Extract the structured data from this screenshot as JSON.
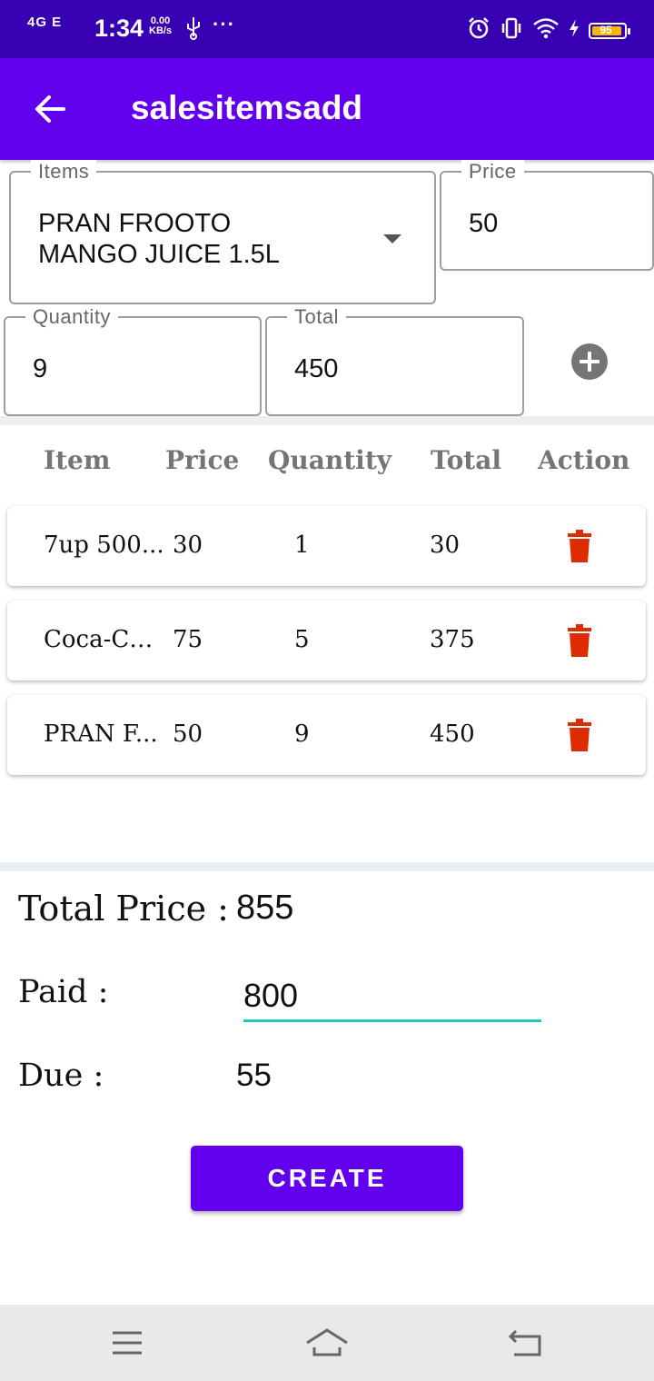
{
  "status_bar": {
    "signal_text": "4G E",
    "time": "1:34",
    "speed_value": "0.00",
    "speed_unit": "KB/s",
    "battery": "95",
    "colors": {
      "background": "#3700b3",
      "battery_fill": "#f5b800"
    }
  },
  "app_bar": {
    "title": "salesitemsadd",
    "back_icon": "arrow-left-icon",
    "color": "#6200ee"
  },
  "form": {
    "items_label": "Items",
    "items_value_line1": "PRAN FROOTO",
    "items_value_line2": "MANGO JUICE 1.5L",
    "price_label": "Price",
    "price_value": "50",
    "quantity_label": "Quantity",
    "quantity_value": "9",
    "total_label": "Total",
    "total_value": "450",
    "add_icon": "plus-circle-icon"
  },
  "table": {
    "headers": [
      "Item",
      "Price",
      "Quantity",
      "Total",
      "Action"
    ],
    "rows": [
      {
        "item": "7up 500...",
        "price": "30",
        "quantity": "1",
        "total": "30"
      },
      {
        "item": "Coca-Co...",
        "price": "75",
        "quantity": "5",
        "total": "375"
      },
      {
        "item": "PRAN F...",
        "price": "50",
        "quantity": "9",
        "total": "450"
      }
    ],
    "delete_icon": "trash-icon",
    "delete_color": "#dd2c00"
  },
  "summary": {
    "total_price_label": "Total Price :",
    "total_price_value": "855",
    "paid_label": "Paid :",
    "paid_value": "800",
    "due_label": "Due :",
    "due_value": "55",
    "underline_color": "#26c6c0"
  },
  "create_button": {
    "label": "CREATE"
  },
  "nav_bar": {
    "icons": [
      "menu-icon",
      "home-icon",
      "back-icon"
    ]
  }
}
